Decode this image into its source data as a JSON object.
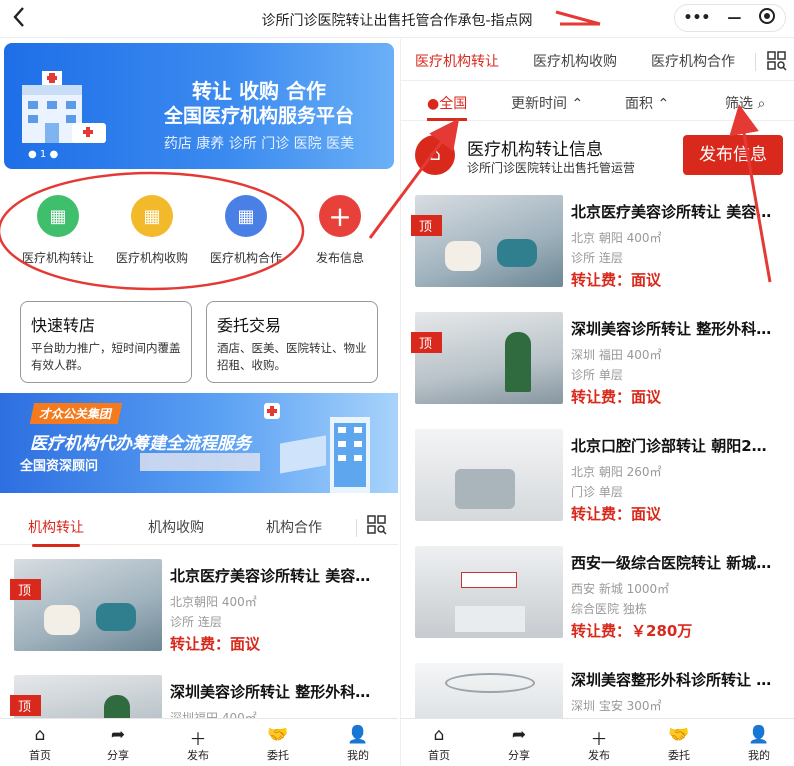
{
  "topbar": {
    "back_icon": "chevron-left-icon",
    "title": "诊所门诊医院转让出售托管合作承包-指点网",
    "more_icon": "more-dots-icon",
    "minimize_icon": "minimize-icon",
    "close_icon": "target-close-icon"
  },
  "left": {
    "banner": {
      "line1": "转让 收购 合作",
      "line2": "全国医疗机构服务平台",
      "line3": "药店 康养 诊所 门诊 医院 医美",
      "pager": "1"
    },
    "icons": [
      {
        "label": "医疗机构转让",
        "icon": "hospital-transfer-icon",
        "color": "#3fbf6b"
      },
      {
        "label": "医疗机构收购",
        "icon": "hospital-acquire-icon",
        "color": "#f2b92a"
      },
      {
        "label": "医疗机构合作",
        "icon": "hospital-cooperate-icon",
        "color": "#4a7fe6"
      },
      {
        "label": "发布信息",
        "icon": "plus-icon",
        "color": "#e8403a"
      }
    ],
    "cards": [
      {
        "title": "快速转店",
        "desc": "平台助力推广，短时间内覆盖有效人群。"
      },
      {
        "title": "委托交易",
        "desc": "酒店、医美、医院转让、物业招租、收购。"
      }
    ],
    "banner2": {
      "tag": "才众公关集团",
      "line1": "医疗机构代办筹建全流程服务",
      "line2": "全国资深顾问"
    },
    "tabs": [
      "机构转让",
      "机构收购",
      "机构合作"
    ],
    "items": [
      {
        "top": "顶",
        "title": "北京医疗美容诊所转让 美容…",
        "meta1": "北京朝阳 400㎡",
        "meta2": "诊所 连层",
        "fee": "转让费：面议"
      },
      {
        "top": "顶",
        "title": "深圳美容诊所转让 整形外科…",
        "meta1": "深圳福田 400㎡",
        "meta2": "",
        "fee": ""
      }
    ]
  },
  "right": {
    "tabs": [
      "医疗机构转让",
      "医疗机构收购",
      "医疗机构合作"
    ],
    "filters": [
      "全国",
      "更新时间",
      "面积",
      "筛选"
    ],
    "header": {
      "title": "医疗机构转让信息",
      "subtitle": "诊所门诊医院转让出售托管运营",
      "publish": "发布信息"
    },
    "items": [
      {
        "top": "顶",
        "title": "北京医疗美容诊所转让 美容…",
        "meta1": "北京 朝阳 400㎡",
        "meta2": "诊所 连层",
        "fee": "转让费：面议"
      },
      {
        "top": "顶",
        "title": "深圳美容诊所转让 整形外科…",
        "meta1": "深圳 福田 400㎡",
        "meta2": "诊所 单层",
        "fee": "转让费：面议"
      },
      {
        "top": "",
        "title": "北京口腔门诊部转让 朝阳2…",
        "meta1": "北京 朝阳 260㎡",
        "meta2": "门诊 单层",
        "fee": "转让费：面议"
      },
      {
        "top": "",
        "title": "西安一级综合医院转让 新城…",
        "meta1": "西安 新城 1000㎡",
        "meta2": "综合医院 独栋",
        "fee": "转让费：￥280万"
      },
      {
        "top": "",
        "title": "深圳美容整形外科诊所转让 …",
        "meta1": "深圳 宝安 300㎡",
        "meta2": "",
        "fee": ""
      }
    ]
  },
  "bottomnav": [
    {
      "label": "首页",
      "icon": "home-icon"
    },
    {
      "label": "分享",
      "icon": "share-icon"
    },
    {
      "label": "发布",
      "icon": "plus-icon"
    },
    {
      "label": "委托",
      "icon": "handshake-icon"
    },
    {
      "label": "我的",
      "icon": "user-icon"
    }
  ],
  "colors": {
    "accent": "#d8291c",
    "annotation": "#e53935"
  }
}
